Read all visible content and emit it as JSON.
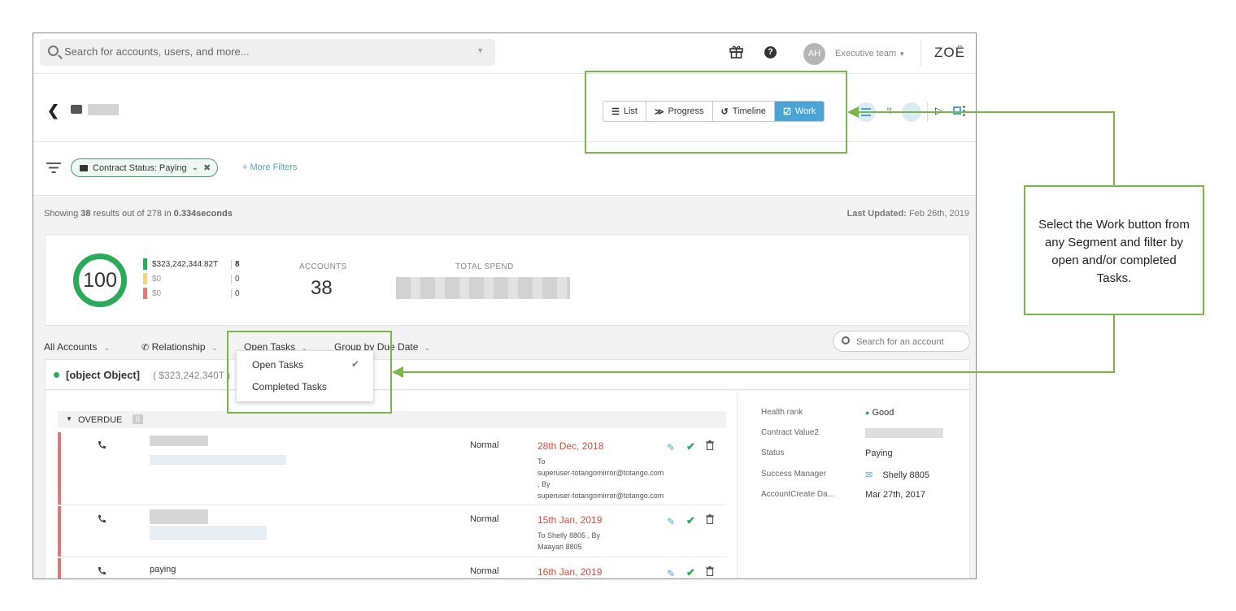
{
  "topbar": {
    "search_placeholder": "Search for accounts, users, and more...",
    "avatar_initials": "AH",
    "team": "Executive team",
    "logo": "ZOË"
  },
  "header": {
    "views": [
      {
        "label": "List",
        "icon": "list-icon",
        "active": false
      },
      {
        "label": "Progress",
        "icon": "progress-icon",
        "active": false
      },
      {
        "label": "Timeline",
        "icon": "timeline-icon",
        "active": false
      },
      {
        "label": "Work",
        "icon": "work-icon",
        "active": true
      }
    ],
    "active_color": "#4aa4d6"
  },
  "filters": {
    "chip_label": "Contract Status: Paying",
    "more_filters": "+ More Filters"
  },
  "results": {
    "showing_prefix": "Showing",
    "count": "38",
    "mid": "results out of 278 in",
    "time": "0.334seconds",
    "last_updated_label": "Last Updated:",
    "last_updated_value": "Feb 26th, 2019"
  },
  "stats": {
    "health_score": "100",
    "legend": [
      {
        "value": "$323,242,344.82T",
        "count": "8",
        "color": "#2bab5a"
      },
      {
        "value": "$0",
        "count": "0",
        "color": "#f2d27a"
      },
      {
        "value": "$0",
        "count": "0",
        "color": "#e07a7a"
      }
    ],
    "accounts_label": "ACCOUNTS",
    "accounts_value": "38",
    "spend_label": "TOTAL SPEND"
  },
  "controls": {
    "all_accounts": "All Accounts",
    "relationship": "Relationship",
    "open_tasks": "Open Tasks",
    "group_by": "Group by Due Date",
    "account_search_placeholder": "Search for an account"
  },
  "dropdown": {
    "options": [
      "Open Tasks",
      "Completed Tasks"
    ],
    "selected": "Open Tasks"
  },
  "segment": {
    "name": "[object Object]",
    "amount": "( $323,242,340T )"
  },
  "tasks": {
    "group_label": "OVERDUE",
    "group_count": "0",
    "rows": [
      {
        "priority": "Normal",
        "due": "28th Dec, 2018",
        "meta": [
          "To",
          "superuser-totangomirror@totango.com",
          ", By",
          "superuser-totangomirror@totango.com"
        ],
        "subject": ""
      },
      {
        "priority": "Normal",
        "due": "15th Jan, 2019",
        "meta": [
          "To Shelly 8805 , By",
          "Maayan 8805"
        ],
        "subject": ""
      },
      {
        "priority": "Normal",
        "due": "16th Jan, 2019",
        "meta": [],
        "subject": "paying"
      }
    ]
  },
  "details": {
    "rows": [
      {
        "label": "Health rank",
        "value": "Good"
      },
      {
        "label": "Contract Value2",
        "value": ""
      },
      {
        "label": "Status",
        "value": "Paying"
      },
      {
        "label": "Success Manager",
        "value": "Shelly 8805"
      },
      {
        "label": "AccountCreate Da...",
        "value": "Mar 27th, 2017"
      }
    ]
  },
  "callout": {
    "text": "Select the Work button from any Segment and filter by open and/or completed Tasks.",
    "color": "#7ab648"
  }
}
